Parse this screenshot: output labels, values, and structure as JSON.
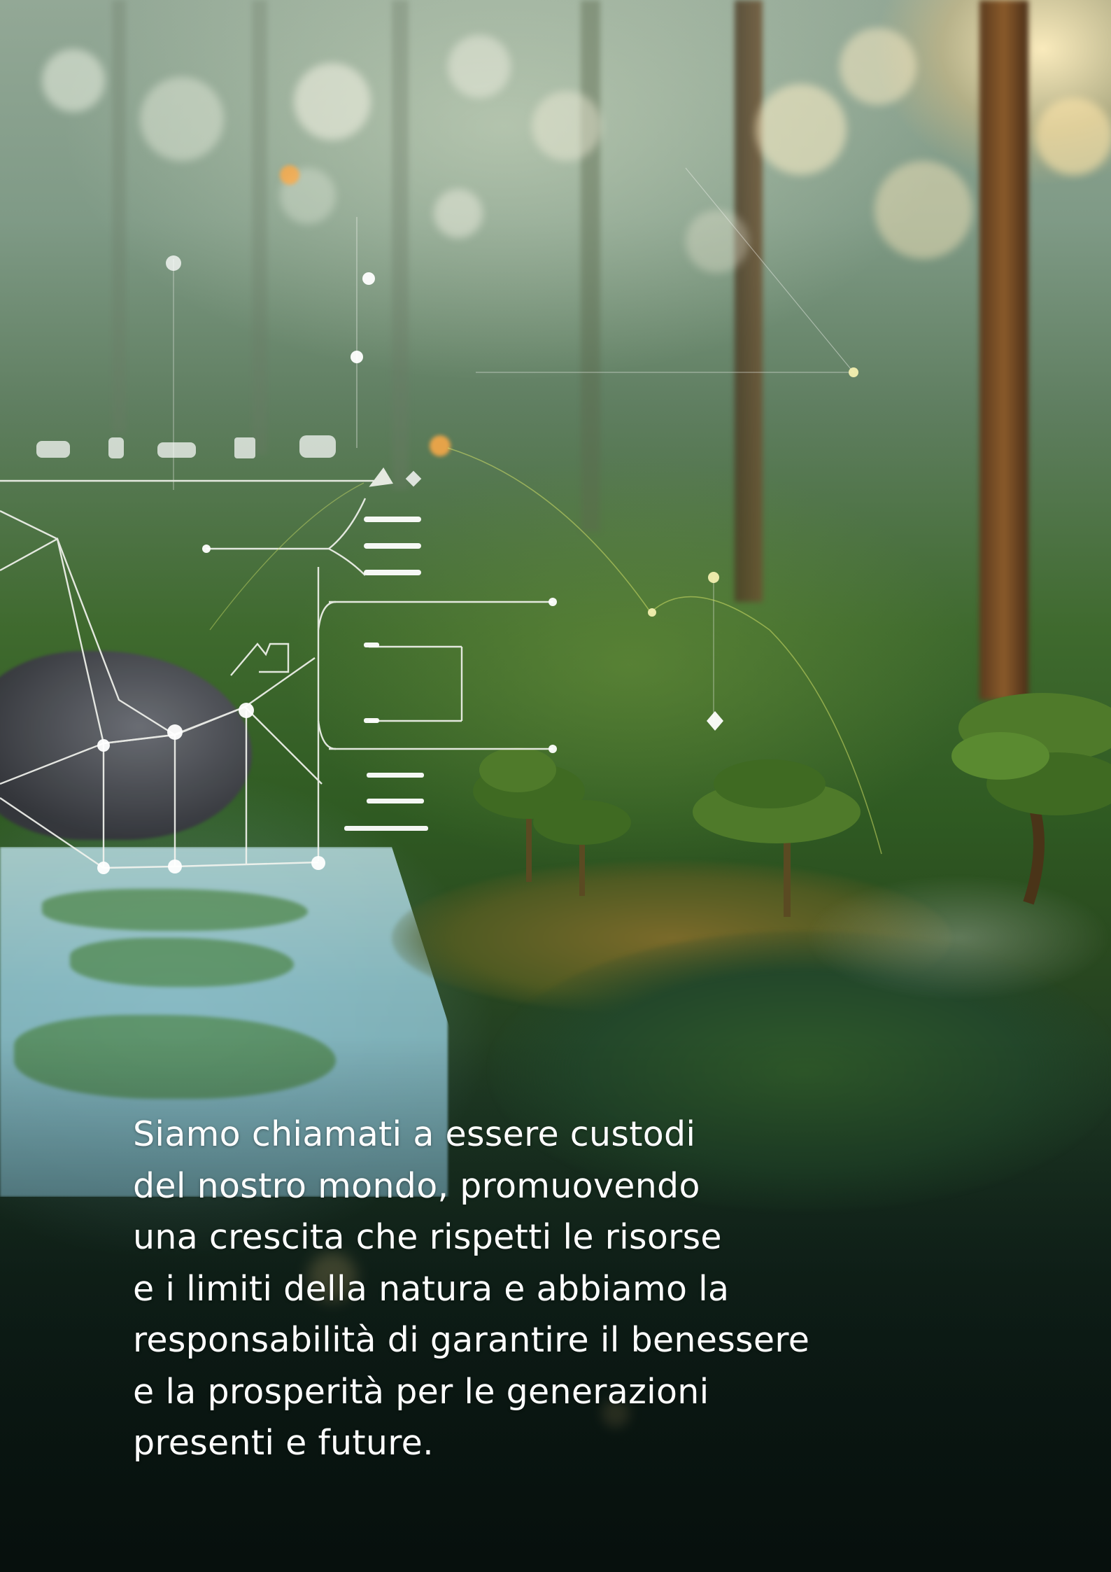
{
  "quote": {
    "text": "Siamo chiamati a essere custodi\ndel nostro mondo, promuovendo\nuna crescita che rispetti le risorse\ne i limiti della natura e abbiamo la\nresponsabilità di garantire il benessere\ne la prosperità per le generazioni\npresenti e future."
  },
  "icons": [
    "network-hud-icon",
    "hand-icon",
    "mini-tree-icon"
  ],
  "colors": {
    "text": "#ffffff",
    "forest_dark": "#15291f",
    "sunlight": "#ffeebe",
    "moss": "#4f7a2a"
  }
}
